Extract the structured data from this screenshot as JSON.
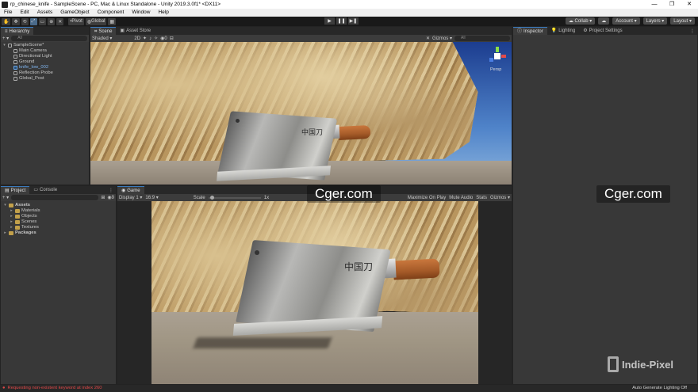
{
  "window": {
    "title": "rp_chinese_knife - SampleScene - PC, Mac & Linux Standalone - Unity 2019.3.0f1* <DX11>",
    "controls": [
      "—",
      "❐",
      "✕"
    ]
  },
  "menu": [
    "File",
    "Edit",
    "Assets",
    "GameObject",
    "Component",
    "Window",
    "Help"
  ],
  "toolbar": {
    "tools": [
      "✋",
      "✥",
      "⟲",
      "⤢",
      "▭",
      "⊕",
      "✕"
    ],
    "pivot": "Pivot",
    "global": "Global",
    "collab": "Collab",
    "account": "Account",
    "layers": "Layers",
    "layout": "Layout"
  },
  "hierarchy": {
    "tab": "Hierarchy",
    "search_placeholder": "All",
    "scene": "SampleScene*",
    "items": [
      "Main Camera",
      "Directional Light",
      "Ground",
      "knife_low_002",
      "Reflection Probe",
      "Global_Post"
    ]
  },
  "scene_view": {
    "tabs": [
      "Scene",
      "Asset Store"
    ],
    "shading": "Shaded",
    "mode_2d": "2D",
    "gizmos": "Gizmos",
    "search_placeholder": "All",
    "persp": "Persp"
  },
  "project": {
    "tabs": [
      "Project",
      "Console"
    ],
    "assets_label": "Assets",
    "folders": [
      "Materials",
      "Objects",
      "Scenes",
      "Textures"
    ],
    "packages_label": "Packages",
    "count": "9"
  },
  "game_view": {
    "tab": "Game",
    "display": "Display 1",
    "aspect": "16:9",
    "scale_label": "Scale",
    "scale_value": "1x",
    "scale_fraction": 0.03,
    "maximize": "Maximize On Play",
    "mute": "Mute Audio",
    "stats": "Stats",
    "gizmos": "Gizmos"
  },
  "inspector": {
    "tabs": [
      "Inspector",
      "Lighting",
      "Project Settings"
    ]
  },
  "engraving": "中国刀",
  "watermarks": {
    "cger": "Cger.com",
    "indie": "Indie-Pixel"
  },
  "status": {
    "error": "Requesting non-existent keyword at index 260",
    "right": "Auto Generate Lighting Off"
  }
}
